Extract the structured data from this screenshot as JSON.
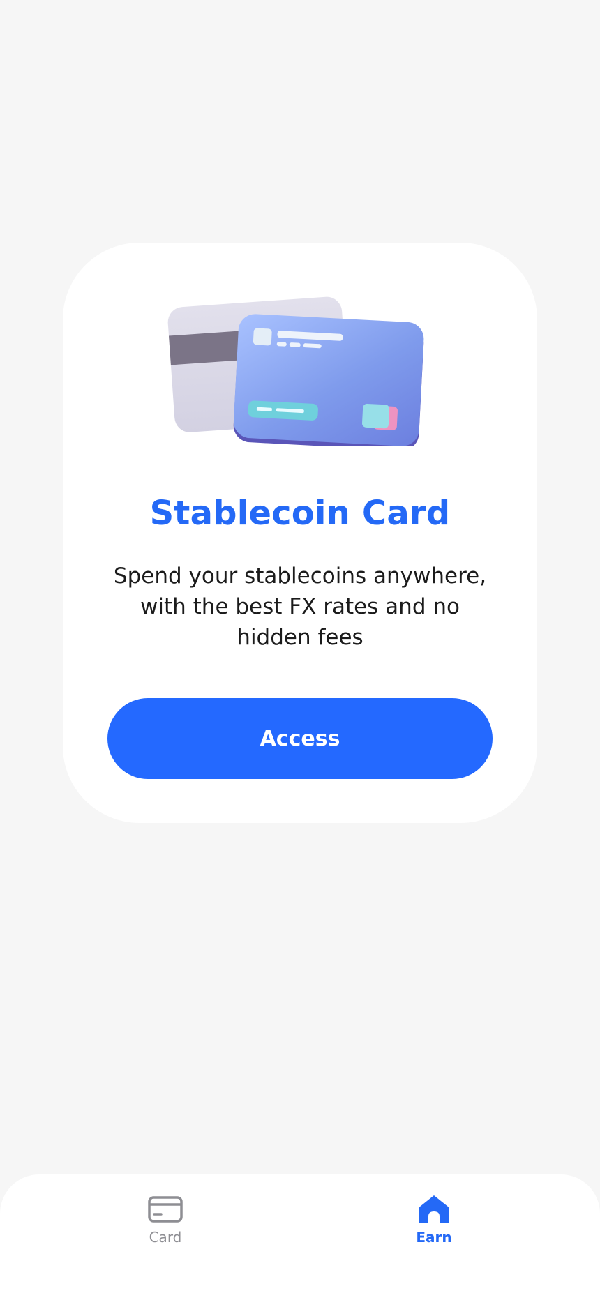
{
  "promo": {
    "title": "Stablecoin Card",
    "description": "Spend your stablecoins anywhere, with the best FX rates and no hidden fees",
    "button_label": "Access",
    "illustration_icon": "credit-cards-illustration"
  },
  "bottom_nav": {
    "items": [
      {
        "label": "Card",
        "icon": "credit-card-icon",
        "active": false
      },
      {
        "label": "Earn",
        "icon": "home-icon",
        "active": true
      }
    ]
  },
  "colors": {
    "background": "#f6f6f6",
    "accent": "#2469f6",
    "card_background": "#ffffff",
    "inactive": "#8e8e93"
  }
}
